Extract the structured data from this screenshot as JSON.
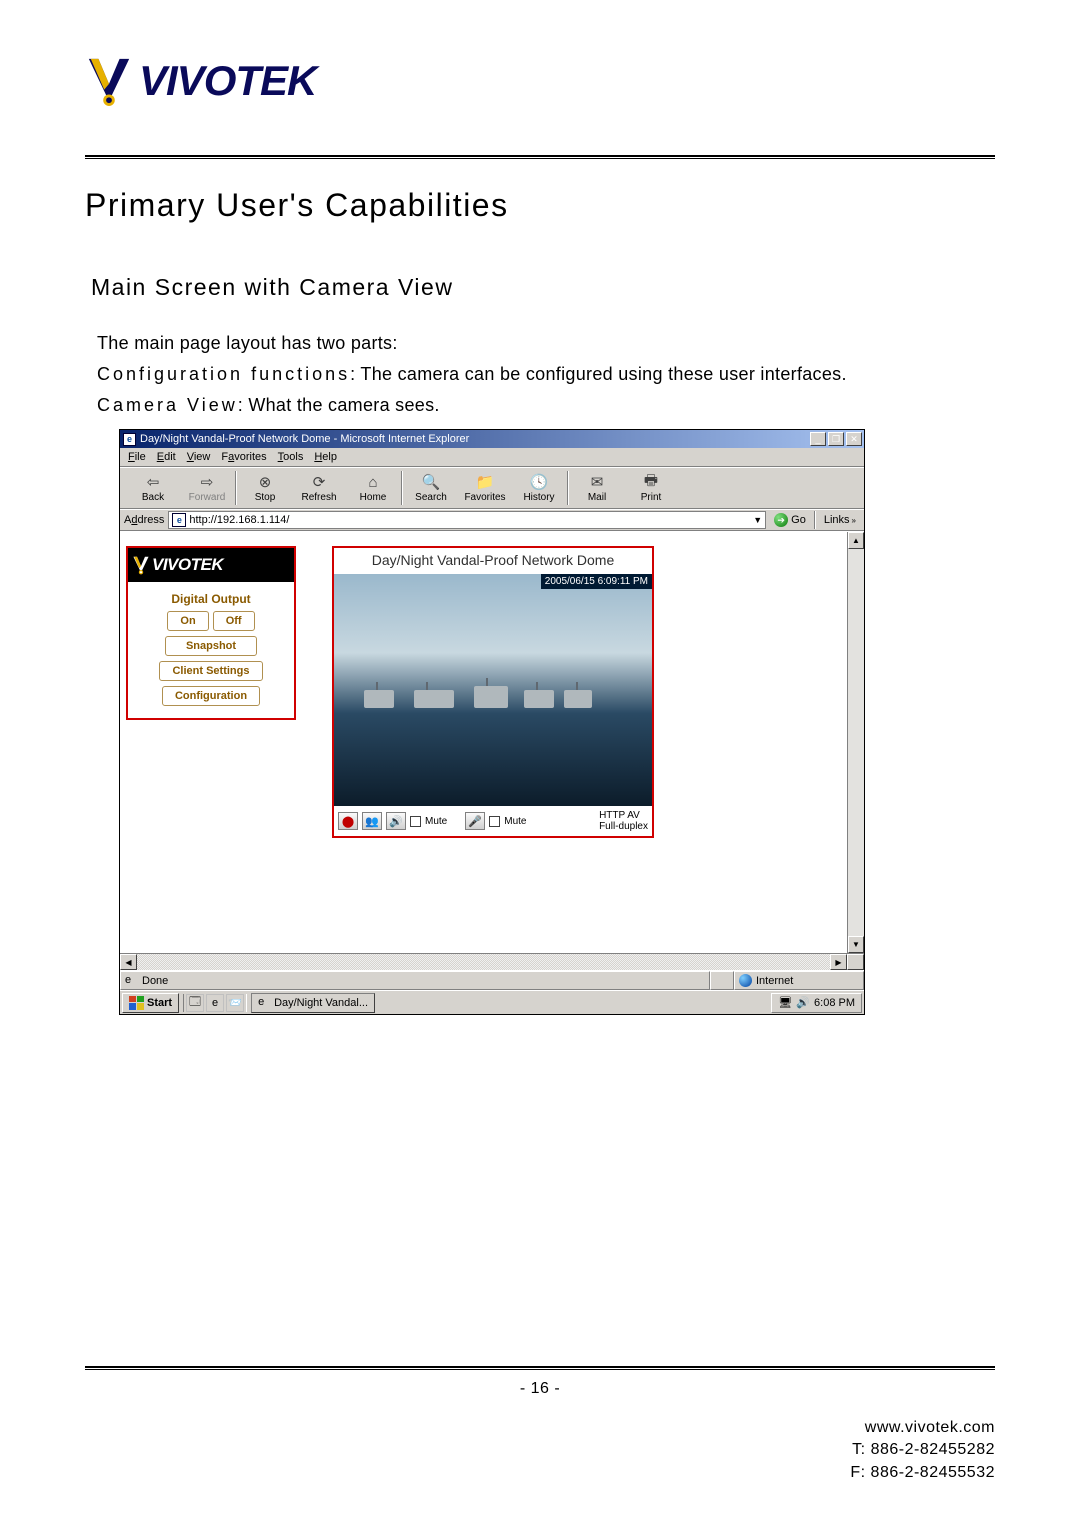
{
  "header": {
    "brand": "VIVOTEK"
  },
  "title": "Primary User's Capabilities",
  "subtitle": "Main Screen with Camera View",
  "body": {
    "line1": "The main page layout has two parts:",
    "line2a": "Configuration functions",
    "line2b": ": The camera can be configured using these user interfaces.",
    "line3a": "Camera View",
    "line3b": ": What the camera sees."
  },
  "ie": {
    "title": "Day/Night Vandal-Proof Network Dome - Microsoft Internet Explorer",
    "menu": {
      "file": "File",
      "edit": "Edit",
      "view": "View",
      "favorites": "Favorites",
      "tools": "Tools",
      "help": "Help"
    },
    "toolbar": {
      "back": "Back",
      "forward": "Forward",
      "stop": "Stop",
      "refresh": "Refresh",
      "home": "Home",
      "search": "Search",
      "favorites": "Favorites",
      "history": "History",
      "mail": "Mail",
      "print": "Print"
    },
    "address_label": "Address",
    "address_value": "http://192.168.1.114/",
    "go": "Go",
    "links": "Links",
    "status_done": "Done",
    "status_zone": "Internet"
  },
  "cam": {
    "brand": "VIVOTEK",
    "title": "Day/Night Vandal-Proof Network Dome",
    "timestamp": "2005/06/15 6:09:11 PM",
    "digital_output": "Digital Output",
    "on": "On",
    "off": "Off",
    "snapshot": "Snapshot",
    "client_settings": "Client Settings",
    "configuration": "Configuration",
    "mute1": "Mute",
    "mute2": "Mute",
    "status_top": "HTTP   AV",
    "status_bottom": "Full-duplex"
  },
  "taskbar": {
    "start": "Start",
    "task": "Day/Night Vandal...",
    "clock": "6:08 PM"
  },
  "page_number": "- 16 -",
  "footer": {
    "url": "www.vivotek.com",
    "tel": "T: 886-2-82455282",
    "fax": "F: 886-2-82455532"
  }
}
